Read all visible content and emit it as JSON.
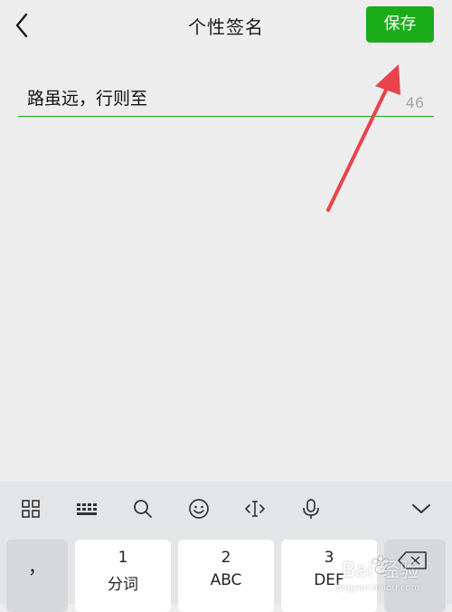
{
  "header": {
    "title": "个性签名",
    "save_label": "保存"
  },
  "signature": {
    "value": "路虽远，行则至",
    "remaining": "46"
  },
  "keyboard": {
    "toolbar": [
      "grid-icon",
      "keyboard-icon",
      "search-icon",
      "emoji-icon",
      "cursor-icon",
      "microphone-icon",
      "collapse-chevron-icon"
    ],
    "keys": {
      "comma": "，",
      "key1_num": "1",
      "key1_sub": "分词",
      "key2_num": "2",
      "key2_sub": "ABC",
      "key3_num": "3",
      "key3_sub": "DEF"
    }
  },
  "watermark": {
    "text": "Bai  经验",
    "url": "jingyan.baidu.com"
  },
  "colors": {
    "accent": "#1aad19",
    "annotation_arrow": "#e8434b",
    "background": "#ededed"
  }
}
